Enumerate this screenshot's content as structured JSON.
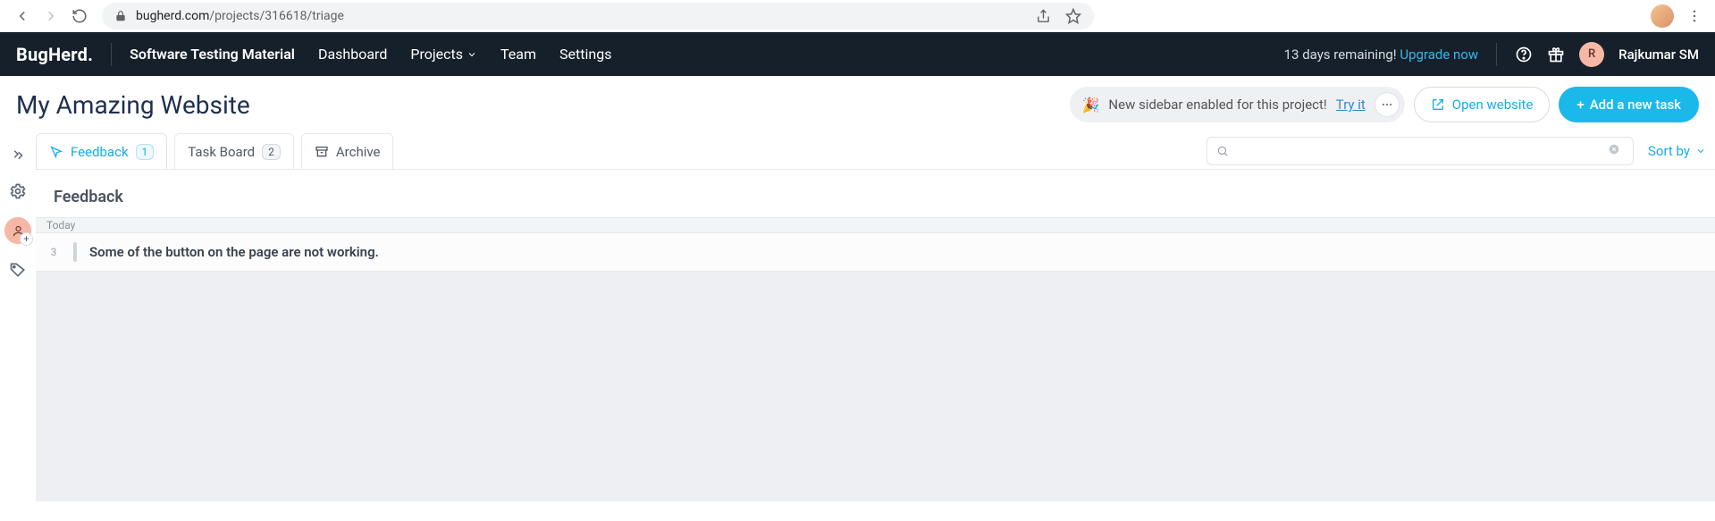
{
  "browser": {
    "url_domain": "bugherd.com",
    "url_path": "/projects/316618/triage"
  },
  "header": {
    "logo": "BugHerd",
    "workspace": "Software Testing Material",
    "nav": {
      "dashboard": "Dashboard",
      "projects": "Projects",
      "team": "Team",
      "settings": "Settings"
    },
    "trial_text": "13 days remaining!",
    "upgrade": "Upgrade now",
    "user_initial": "R",
    "user_name": "Rajkumar SM"
  },
  "project": {
    "title": "My Amazing Website",
    "notice_text": "New sidebar enabled for this project!",
    "notice_link": "Try it",
    "open_website": "Open website",
    "add_task": "Add a new task"
  },
  "tabs": {
    "feedback": {
      "label": "Feedback",
      "count": "1"
    },
    "taskboard": {
      "label": "Task Board",
      "count": "2"
    },
    "archive": {
      "label": "Archive"
    }
  },
  "controls": {
    "sort_label": "Sort by"
  },
  "section": {
    "title": "Feedback",
    "group": "Today"
  },
  "tasks": [
    {
      "num": "3",
      "text": "Some of the button on the page are not working."
    }
  ]
}
